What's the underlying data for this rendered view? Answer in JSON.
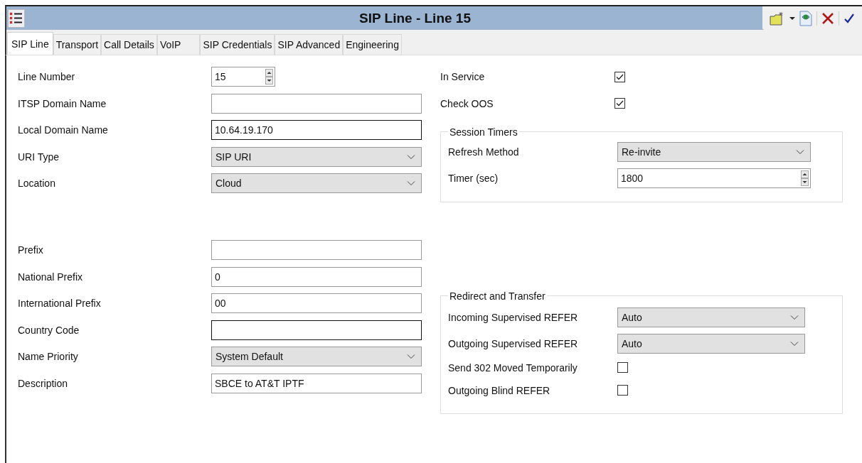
{
  "window": {
    "title": "SIP Line - Line 15"
  },
  "tabs": [
    {
      "label": "SIP Line",
      "selected": true
    },
    {
      "label": "Transport",
      "selected": false
    },
    {
      "label": "Call Details",
      "selected": false
    },
    {
      "label": "VoIP",
      "selected": false
    },
    {
      "label": "SIP Credentials",
      "selected": false
    },
    {
      "label": "SIP Advanced",
      "selected": false
    },
    {
      "label": "Engineering",
      "selected": false
    }
  ],
  "left_fields_top": [
    {
      "label": "Line Number",
      "kind": "spin",
      "value": "15"
    },
    {
      "label": "ITSP Domain Name",
      "kind": "text",
      "focused": false
    },
    {
      "label": "Local Domain Name",
      "kind": "text",
      "value": "10.64.19.170",
      "focused": true
    },
    {
      "label": "URI Type",
      "kind": "select",
      "value": "SIP URI"
    },
    {
      "label": "Location",
      "kind": "select",
      "value": "Cloud"
    }
  ],
  "left_fields_bottom": [
    {
      "label": "Prefix",
      "kind": "text",
      "focused": false
    },
    {
      "label": "National Prefix",
      "kind": "text",
      "value": "0",
      "focused": false
    },
    {
      "label": "International Prefix",
      "kind": "text",
      "value": "00",
      "focused": false
    },
    {
      "label": "Country Code",
      "kind": "text",
      "focused": true
    },
    {
      "label": "Name Priority",
      "kind": "select",
      "value": "System Default"
    },
    {
      "label": "Description",
      "kind": "text",
      "value": "SBCE to AT&T IPTF",
      "focused": false
    }
  ],
  "right_fields": [
    {
      "label": "In Service",
      "kind": "check",
      "checked": true
    },
    {
      "label": "Check OOS",
      "kind": "check",
      "checked": true
    }
  ],
  "session_timers": {
    "title": "Session Timers",
    "fields": [
      {
        "label": "Refresh Method",
        "kind": "select",
        "value": "Re-invite"
      },
      {
        "label": "Timer (sec)",
        "kind": "spin",
        "value": "1800"
      }
    ]
  },
  "redirect_and_transfer": {
    "title": "Redirect and Transfer",
    "fields": [
      {
        "label": "Incoming Supervised REFER",
        "kind": "select",
        "value": "Auto"
      },
      {
        "label": "Outgoing Supervised REFER",
        "kind": "select",
        "value": "Auto"
      },
      {
        "label": "Send 302 Moved Temporarily",
        "kind": "check",
        "checked": false
      },
      {
        "label": "Outgoing Blind REFER",
        "kind": "check",
        "checked": false
      }
    ]
  }
}
